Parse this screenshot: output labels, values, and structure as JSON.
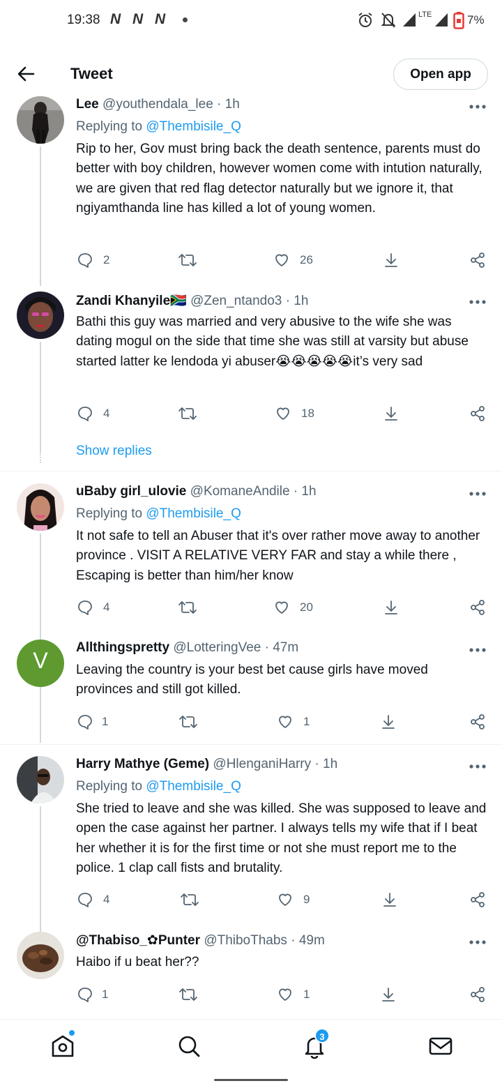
{
  "status_bar": {
    "time": "19:38",
    "network_glyph": "N",
    "network": "LTE",
    "battery": "7%"
  },
  "header": {
    "title": "Tweet",
    "open_app_label": "Open app"
  },
  "tweets": [
    {
      "name": "Lee",
      "handle": "@youthendala_lee",
      "time": "1h",
      "replying_label": "Replying to ",
      "replying_to": "@Thembisile_Q",
      "text": "Rip to her, Gov must bring back the death sentence, parents must do better with boy children, however women come with intution naturally, we are given that red flag detector naturally but we ignore it, that ngiyamthanda line has killed a lot of young women.",
      "replies": "2",
      "retweets": "",
      "likes": "26"
    },
    {
      "name": "Zandi Khanyile🇿🇦",
      "handle": "@Zen_ntando3",
      "time": "1h",
      "text": "Bathi this guy was married and very abusive to the wife she was dating mogul on the side that time she was still at varsity but abuse started latter ke lendoda yi abuser😭😭😭😭😭it’s very sad",
      "replies": "4",
      "retweets": "",
      "likes": "18",
      "show_replies": "Show replies"
    },
    {
      "name": "uBaby girl_ulovie",
      "handle": "@KomaneAndile",
      "time": "1h",
      "replying_label": "Replying to ",
      "replying_to": "@Thembisile_Q",
      "text": "It not safe to tell an Abuser that it's over rather move away to another province . VISIT A RELATIVE VERY FAR and stay a while there , Escaping is better than him/her know",
      "replies": "4",
      "retweets": "",
      "likes": "20"
    },
    {
      "name": "Allthingspretty",
      "handle": "@LotteringVee",
      "time": "47m",
      "avatar_letter": "V",
      "text": "Leaving the country is your best bet cause girls have moved provinces and still got killed.",
      "replies": "1",
      "retweets": "",
      "likes": "1"
    },
    {
      "name": "Harry Mathye (Geme)",
      "handle": "@HlenganiHarry",
      "time": "1h",
      "replying_label": "Replying to ",
      "replying_to": "@Thembisile_Q",
      "text": "She tried to leave and she was killed. She was supposed to leave and open the case against her partner. I always tells my wife that if I beat her whether it is for the first time or not she must report me to the police. 1 clap call fists and brutality.",
      "replies": "4",
      "retweets": "",
      "likes": "9"
    },
    {
      "name": "@Thabiso_✿Punter",
      "handle": "@ThiboThabs",
      "time": "49m",
      "text": "Haibo if u beat her??",
      "replies": "1",
      "retweets": "",
      "likes": "1"
    }
  ],
  "bottom_nav": {
    "items": [
      "home-icon",
      "search-icon",
      "notifications-icon",
      "messages-icon"
    ],
    "notifications_count": "3"
  },
  "colors": {
    "accent": "#1d9bf0",
    "text": "#0f1419",
    "secondary": "#536471",
    "divider": "#eff3f4"
  }
}
